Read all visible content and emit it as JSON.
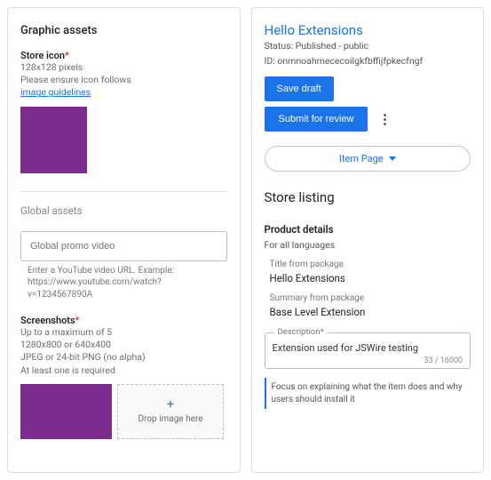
{
  "left": {
    "heading": "Graphic assets",
    "storeIcon": {
      "label": "Store icon",
      "req": "*",
      "dims": "128x128 pixels",
      "ensure": "Please ensure icon follows",
      "guidelinesLink": "image guidelines"
    },
    "globalAssetsLabel": "Global assets",
    "promoPlaceholder": "Global promo video",
    "promoHint": "Enter a YouTube video URL. Example: https://www.youtube.com/watch?v=1234567890A",
    "screenshots": {
      "label": "Screenshots",
      "req": "*",
      "line1": "Up to a maximum of 5",
      "line2": "1280x800 or 640x400",
      "line3": "JPEG or 24-bit PNG (no alpha)",
      "line4": "At least one is required",
      "dropLabel": "Drop image here"
    }
  },
  "right": {
    "title": "Hello Extensions",
    "status": "Status: Published - public",
    "id": "ID: onmnoahmececoilgkfbffijfpkecfngf",
    "saveDraft": "Save draft",
    "submit": "Submit for review",
    "itemPage": "Item Page",
    "storeListing": "Store listing",
    "productDetails": "Product details",
    "forAll": "For all languages",
    "titleFromLabel": "Title from package",
    "titleFromValue": "Hello Extensions",
    "summaryFromLabel": "Summary from package",
    "summaryFromValue": "Base Level Extension",
    "descLegend": "Description*",
    "descValue": "Extension used for JSWire testing",
    "descCounter": "33 / 16000",
    "note": "Focus on explaining what the item does and why users should install it"
  }
}
